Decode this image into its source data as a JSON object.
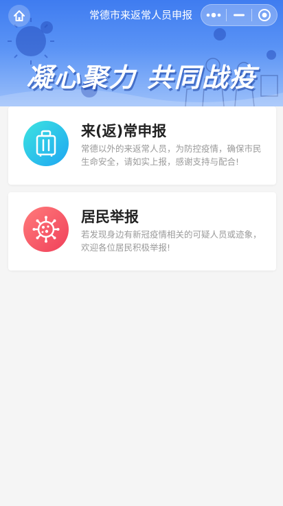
{
  "navbar": {
    "title": "常德市来返常人员申报",
    "home_icon": "home-icon",
    "more_icon": "more-dots-icon",
    "minimize_icon": "minimize-icon",
    "close_icon": "target-close-icon"
  },
  "banner": {
    "slogan": "凝心聚力  共同战疫"
  },
  "cards": [
    {
      "title": "来(返)常申报",
      "description": "常德以外的来返常人员，为防控疫情，确保市民生命安全，请如实上报，感谢支持与配合!",
      "icon": "luggage-icon"
    },
    {
      "title": "居民举报",
      "description": "若发现身边有新冠疫情相关的可疑人员或迹象，欢迎各位居民积极举报!",
      "icon": "virus-icon"
    }
  ],
  "colors": {
    "banner_blue": "#3f7cf0",
    "luggage_icon_start": "#3de3e0",
    "luggage_icon_end": "#1ea6f2",
    "virus_icon_start": "#ff7b7b",
    "virus_icon_end": "#f0405a",
    "background": "#f5f5f5"
  }
}
